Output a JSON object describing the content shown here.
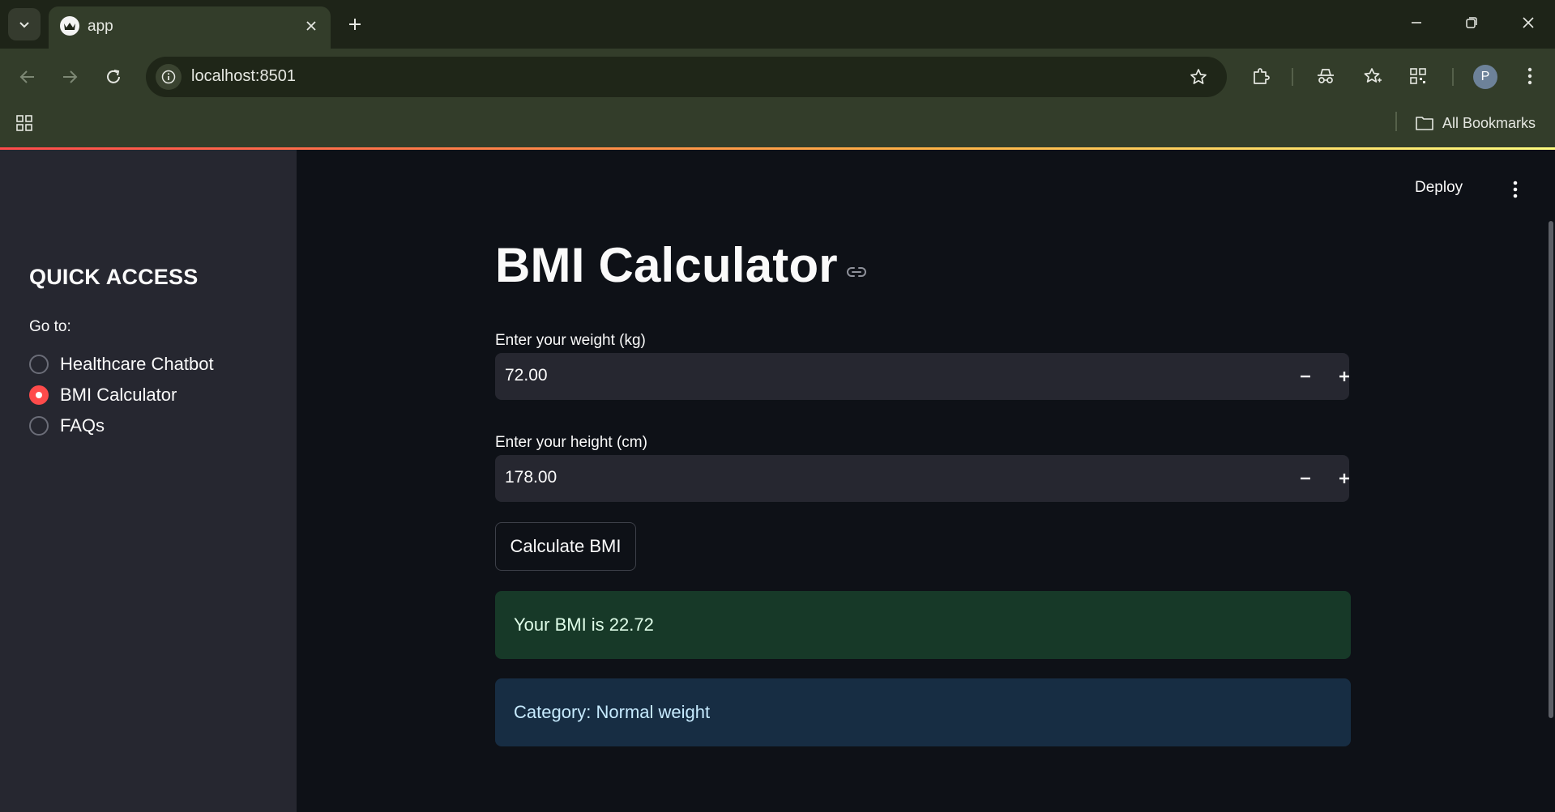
{
  "browser": {
    "tab_title": "app",
    "url": "localhost:8501",
    "bookmarks_label": "All Bookmarks",
    "profile_initial": "P",
    "icons": [
      "tab-list-icon",
      "favicon-crown-icon",
      "close-icon",
      "plus-icon",
      "minimize-icon",
      "restore-icon",
      "window-close-icon",
      "back-icon",
      "forward-icon",
      "reload-icon",
      "site-info-icon",
      "bookmark-star-icon",
      "extensions-icon",
      "incognito-icon",
      "favorites-icon",
      "qr-icon",
      "more-vert-icon",
      "apps-grid-icon",
      "folder-icon"
    ]
  },
  "sidebar": {
    "heading": "QUICK ACCESS",
    "goto_label": "Go to:",
    "options": [
      {
        "label": "Healthcare Chatbot",
        "selected": false
      },
      {
        "label": "BMI Calculator",
        "selected": true
      },
      {
        "label": "FAQs",
        "selected": false
      }
    ]
  },
  "header": {
    "deploy_label": "Deploy"
  },
  "main": {
    "title": "BMI Calculator",
    "weight": {
      "label": "Enter your weight (kg)",
      "value": "72.00"
    },
    "height": {
      "label": "Enter your height (cm)",
      "value": "178.00"
    },
    "calculate_label": "Calculate BMI",
    "result_text": "Your BMI is 22.72",
    "category_text": "Category: Normal weight"
  },
  "colors": {
    "accent": "#ff4b4b",
    "app_background": "#0e1117",
    "sidebar_background": "#262730",
    "success_background": "#173928",
    "info_background": "#172d43"
  }
}
